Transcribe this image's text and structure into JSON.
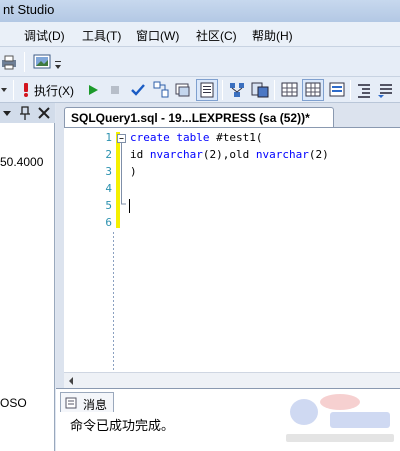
{
  "app": {
    "title": "nt Studio"
  },
  "menu": [
    {
      "label": "试(D)"
    },
    {
      "label": "调试(D)"
    },
    {
      "label": "工具(T)"
    },
    {
      "label": "窗口(W)"
    },
    {
      "label": "社区(C)"
    },
    {
      "label": "帮助(H)"
    }
  ],
  "toolbar": {
    "execute_label": "执行(X)"
  },
  "left_panel": {
    "value_text": "50.4000",
    "bottom_text": "OSO"
  },
  "editor": {
    "tab_title": "SQLQuery1.sql - 19...LEXPRESS (sa (52))*",
    "line_numbers": [
      "1",
      "2",
      "3",
      "4",
      "5",
      "6"
    ],
    "lines": {
      "l1_kw": "create table",
      "l1_rest": " #test1(",
      "l2_a": "id ",
      "l2_t1": "nvarchar",
      "l2_b": "(2),old ",
      "l2_t2": "nvarchar",
      "l2_c": "(2)",
      "l3": ")"
    }
  },
  "messages": {
    "tab_label": "消息",
    "text": "命令已成功完成。"
  },
  "colors": {
    "keyword": "#0000ff",
    "line_number": "#2b91af",
    "change_bar": "#f5f000"
  }
}
